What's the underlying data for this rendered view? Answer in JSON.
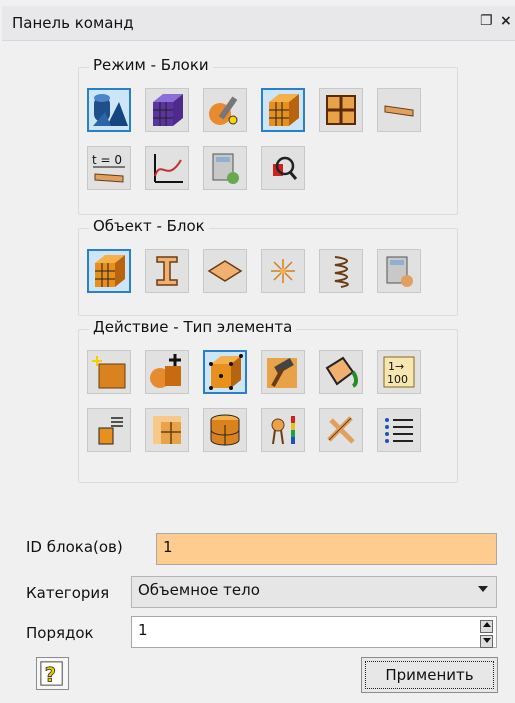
{
  "header": {
    "title": "Панель команд",
    "float_icon": "float-icon",
    "close_icon": "close-icon"
  },
  "groups": {
    "mode": {
      "title": "Режим - Блоки",
      "icons": [
        "geometry-shapes-icon",
        "mesh-cube-purple-icon",
        "tools-sphere-icon",
        "mesh-cube-orange-icon",
        "grid-quad-icon",
        "beam-plank-icon",
        "time-zero-icon",
        "graph-curve-icon",
        "calculator-gear-icon",
        "zoom-search-icon"
      ],
      "t_label": "t = 0"
    },
    "object": {
      "title": "Объект - Блок",
      "icons": [
        "block-cube-icon",
        "beam-i-icon",
        "shell-plate-icon",
        "point-star-icon",
        "spring-icon",
        "calculator-gear-icon"
      ]
    },
    "action": {
      "title": "Действие - Тип элемента",
      "icons": [
        "create-block-icon",
        "add-part-icon",
        "cube-nodes-icon",
        "hammer-icon",
        "paint-bucket-icon",
        "renumber-icon",
        "small-cube-list-icon",
        "split-grid-icon",
        "cylinder-mesh-icon",
        "color-bar-icon",
        "cross-tools-icon",
        "list-icon"
      ],
      "renumber_top": "1→",
      "renumber_bottom": "100"
    }
  },
  "form": {
    "block_id_label": "ID блока(ов)",
    "block_id_value": "1",
    "category_label": "Категория",
    "category_value": "Объемное тело",
    "order_label": "Порядок",
    "order_value": "1"
  },
  "footer": {
    "help_icon": "help-icon",
    "apply_label": "Применить"
  }
}
